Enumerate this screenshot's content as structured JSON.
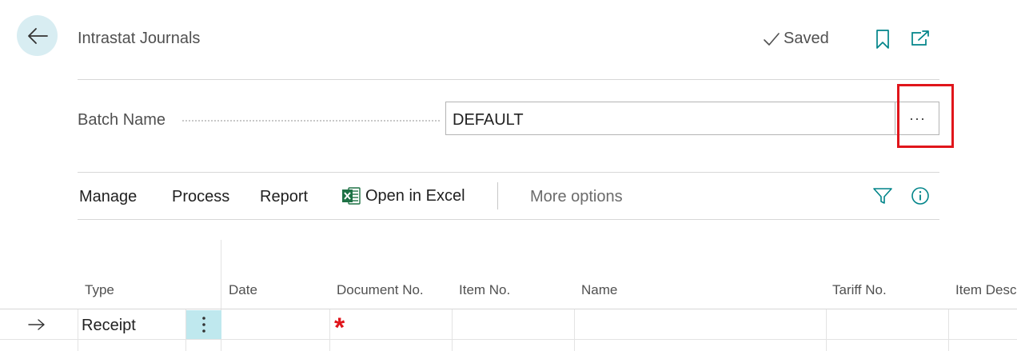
{
  "header": {
    "title": "Intrastat Journals",
    "saved_label": "Saved",
    "icons": [
      "back-arrow-icon",
      "checkmark-icon",
      "bookmark-icon",
      "open-in-new-window-icon"
    ]
  },
  "batch": {
    "label": "Batch Name",
    "value": "DEFAULT",
    "lookup_label": "···"
  },
  "actions": {
    "manage": "Manage",
    "process": "Process",
    "report": "Report",
    "open_in_excel": "Open in Excel",
    "more_options": "More options",
    "icons": [
      "excel-icon",
      "filter-icon",
      "info-icon"
    ]
  },
  "table": {
    "columns": [
      "Type",
      "Date",
      "Document No.",
      "Item No.",
      "Name",
      "Tariff No.",
      "Item Desc"
    ],
    "rows": [
      {
        "type": "Receipt",
        "required_marker": "*"
      }
    ]
  },
  "colors": {
    "accent": "#008489",
    "back_button_bg": "#d8edf2",
    "selected_cell_bg": "#bfe8ee",
    "highlight_border": "#e0151b",
    "required_marker": "#e0151b"
  }
}
